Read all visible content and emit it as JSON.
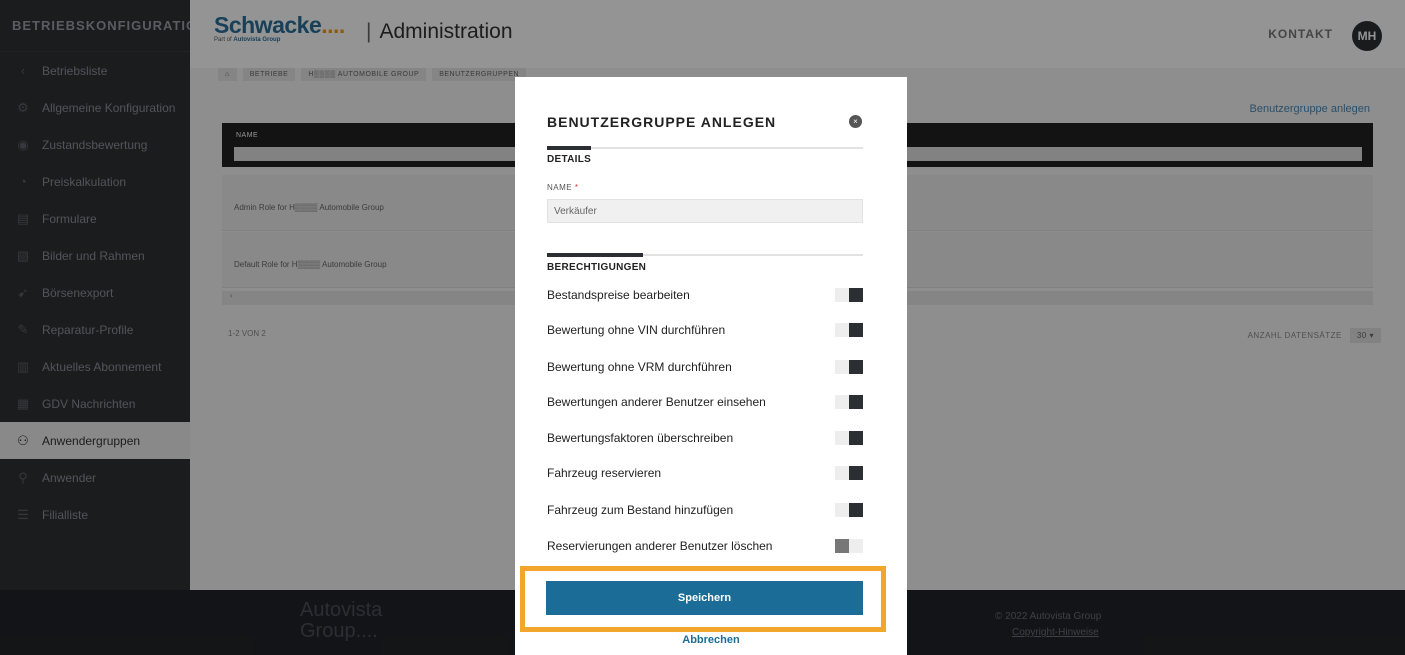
{
  "sidebar": {
    "header": "BETRIEBSKONFIGURATION",
    "items": [
      {
        "label": "Betriebsliste",
        "icon": "‹"
      },
      {
        "label": "Allgemeine Konfiguration",
        "icon": "⚙"
      },
      {
        "label": "Zustandsbewertung",
        "icon": "◉"
      },
      {
        "label": "Preiskalkulation",
        "icon": "◔"
      },
      {
        "label": "Formulare",
        "icon": "▤"
      },
      {
        "label": "Bilder und Rahmen",
        "icon": "▧"
      },
      {
        "label": "Börsenexport",
        "icon": "➹"
      },
      {
        "label": "Reparatur-Profile",
        "icon": "✎"
      },
      {
        "label": "Aktuelles Abonnement",
        "icon": "▥"
      },
      {
        "label": "GDV Nachrichten",
        "icon": "▦"
      },
      {
        "label": "Anwendergruppen",
        "icon": "⚇"
      },
      {
        "label": "Anwender",
        "icon": "⚲"
      },
      {
        "label": "Filialliste",
        "icon": "☰"
      }
    ]
  },
  "header": {
    "logo_main": "Schwacke",
    "logo_dots": "....",
    "logo_sub_prefix": "Part of",
    "logo_sub_brand": "Autovista Group",
    "title": "Administration",
    "title_bar": "|",
    "contact": "KONTAKT",
    "avatar": "MH"
  },
  "breadcrumb": {
    "home": "⌂",
    "items": [
      "BETRIEBE",
      "H▒▒▒▒ AUTOMOBILE GROUP",
      "BENUTZERGRUPPEN"
    ]
  },
  "main": {
    "create_link": "Benutzergruppe anlegen",
    "table_name_header": "NAME",
    "rows": [
      "Admin Role for H▒▒▒▒ Automobile Group",
      "Default Role for H▒▒▒▒ Automobile Group"
    ],
    "scroll_left": "‹",
    "scroll_right": "›",
    "count": "1-2 VON 2",
    "per_page_label": "ANZAHL DATENSÄTZE",
    "per_page_value": "30 ▾"
  },
  "footer": {
    "brand_line1": "Autovista",
    "brand_line2": "Group....",
    "copyright": "© 2022 Autovista Group",
    "hint": "Copyright-Hinweise"
  },
  "modal": {
    "title": "BENUTZERGRUPPE ANLEGEN",
    "close": "×",
    "details_label": "DETAILS",
    "name_label": "NAME",
    "name_required": "*",
    "name_value": "Verkäufer",
    "permissions_label": "BERECHTIGUNGEN",
    "permissions": [
      {
        "label": "Bestandspreise bearbeiten",
        "on": true
      },
      {
        "label": "Bewertung ohne VIN durchführen",
        "on": true
      },
      {
        "label": "Bewertung ohne VRM durchführen",
        "on": true
      },
      {
        "label": "Bewertungen anderer Benutzer einsehen",
        "on": true
      },
      {
        "label": "Bewertungsfaktoren überschreiben",
        "on": true
      },
      {
        "label": "Fahrzeug reservieren",
        "on": true
      },
      {
        "label": "Fahrzeug zum Bestand hinzufügen",
        "on": true
      },
      {
        "label": "Reservierungen anderer Benutzer löschen",
        "on": false
      }
    ],
    "save_label": "Speichern",
    "cancel_label": "Abbrechen"
  },
  "colors": {
    "sidebar_bg": "#2e3135",
    "accent_blue": "#1b6d97",
    "highlight_orange": "#f2a62c"
  }
}
